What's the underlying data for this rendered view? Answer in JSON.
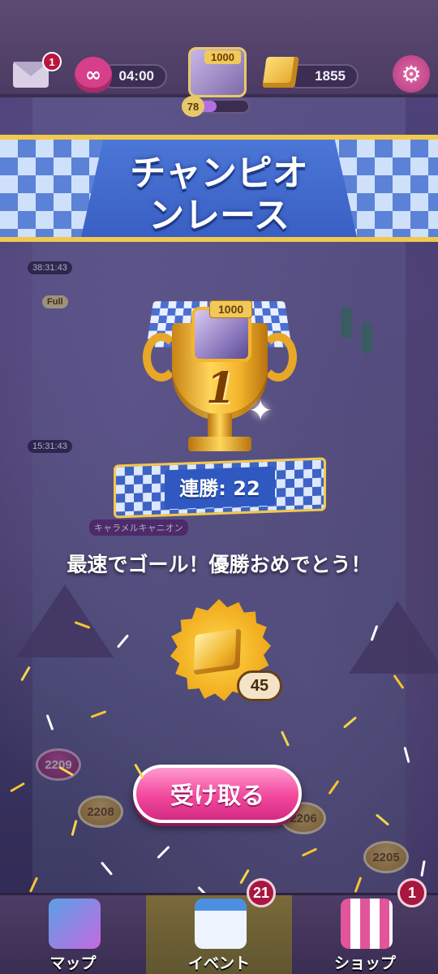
{
  "topbar": {
    "mail_badge": "1",
    "lives_symbol": "∞",
    "lives_timer": "04:00",
    "profile_banner": "1000",
    "player_level": "78",
    "level_progress": 0.5,
    "gold_count": "1855",
    "settings_symbol": "⚙"
  },
  "ribbon": {
    "title_line1": "チャンピオ",
    "title_line2": "ンレース"
  },
  "trophy": {
    "avatar_banner": "1000",
    "rank": "1"
  },
  "streak": {
    "label": "連勝: 22"
  },
  "message": "最速でゴール！優勝おめでとう！",
  "reward": {
    "count": "45",
    "icon": "gold-bar-icon"
  },
  "claim_button": {
    "label": "受け取る"
  },
  "map": {
    "nodes": [
      "2209",
      "2208",
      "2206",
      "2205"
    ],
    "timers": [
      "38:31:43",
      "15:31:43"
    ],
    "full_label": "Full",
    "area_label": "キャラメルキャニオン"
  },
  "bottom_nav": {
    "map_label": "マップ",
    "event_label": "イベント",
    "shop_label": "ショップ",
    "event_badge": "21",
    "shop_badge": "1"
  },
  "colors": {
    "ribbon_blue": "#3a5fc4",
    "accent_pink": "#f2479c",
    "gold": "#f2c94c"
  }
}
